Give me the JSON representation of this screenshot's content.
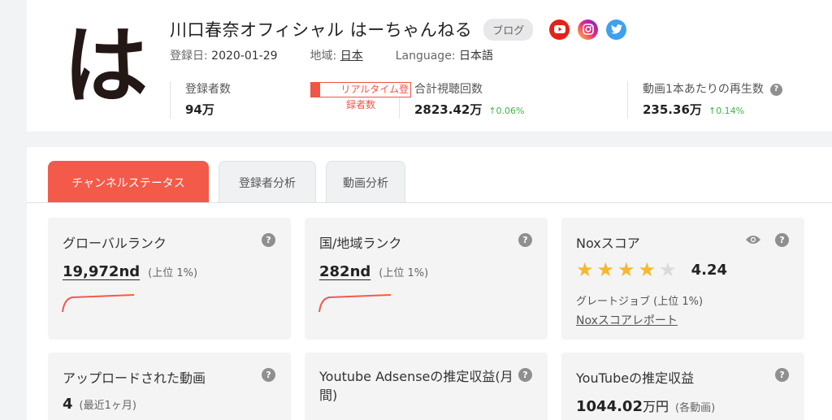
{
  "header": {
    "avatar_char": "は",
    "channel_name": "川口春奈オフィシャル はーちゃんねる",
    "badge": "ブログ",
    "social": [
      {
        "name": "youtube",
        "color": "#e62117"
      },
      {
        "name": "instagram",
        "color": "#ee2a7b"
      },
      {
        "name": "twitter",
        "color": "#3ea1ec"
      }
    ],
    "registered_label": "登録日:",
    "registered_value": "2020-01-29",
    "region_label": "地域:",
    "region_value": "日本",
    "language_label": "Language:",
    "language_value": "日本語"
  },
  "stats": {
    "subscribers_label": "登録者数",
    "subscribers_value": "94万",
    "realtime_line1": "リアルタイム登",
    "realtime_line2": "録者数",
    "views_label": "合計視聴回数",
    "views_value": "2823.42万",
    "views_change": "0.06%",
    "avg_label": "動画1本あたりの再生数",
    "avg_value": "235.36万",
    "avg_change": "0.14%"
  },
  "tabs": [
    {
      "label": "チャンネルステータス",
      "active": true
    },
    {
      "label": "登録者分析",
      "active": false
    },
    {
      "label": "動画分析",
      "active": false
    }
  ],
  "cards": {
    "global_rank": {
      "title": "グローバルランク",
      "value": "19,972nd",
      "sub": "(上位 1%)"
    },
    "country_rank": {
      "title": "国/地域ランク",
      "value": "282nd",
      "sub": "(上位 1%)"
    },
    "nox": {
      "title": "Noxスコア",
      "rating": 4,
      "max_rating": 5,
      "score": "4.24",
      "desc": "グレートジョブ (上位 1%)",
      "link": "Noxスコアレポート"
    },
    "uploads": {
      "title": "アップロードされた動画",
      "value": "4",
      "sub": "(最近1ヶ月)"
    },
    "adsense": {
      "title_line1": "Youtube Adsenseの推定収益(月",
      "title_line2": "間)"
    },
    "revenue": {
      "title": "YouTubeの推定収益",
      "value": "1044.02",
      "unit": "万円",
      "sub": "(各動画)"
    }
  },
  "colors": {
    "accent": "#f35a49",
    "up": "#3bb54a",
    "star": "#f5b82e"
  }
}
